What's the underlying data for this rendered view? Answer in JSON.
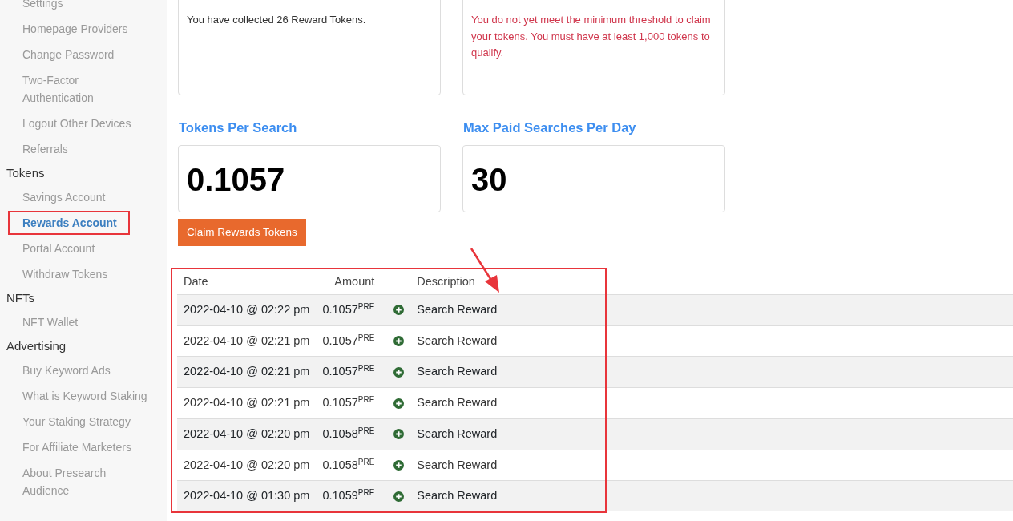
{
  "sidebar": {
    "groups": [
      {
        "items": [
          {
            "label": "Settings",
            "selected": false,
            "highlighted": false
          },
          {
            "label": "Homepage Providers",
            "selected": false,
            "highlighted": false
          },
          {
            "label": "Change Password",
            "selected": false,
            "highlighted": false
          },
          {
            "label": "Two-Factor Authentication",
            "selected": false,
            "highlighted": false
          },
          {
            "label": "Logout Other Devices",
            "selected": false,
            "highlighted": false
          },
          {
            "label": "Referrals",
            "selected": false,
            "highlighted": false
          }
        ]
      },
      {
        "heading": "Tokens",
        "items": [
          {
            "label": "Savings Account",
            "selected": false,
            "highlighted": false
          },
          {
            "label": "Rewards Account",
            "selected": true,
            "highlighted": true
          },
          {
            "label": "Portal Account",
            "selected": false,
            "highlighted": false
          },
          {
            "label": "Withdraw Tokens",
            "selected": false,
            "highlighted": false
          }
        ]
      },
      {
        "heading": "NFTs",
        "items": [
          {
            "label": "NFT Wallet",
            "selected": false,
            "highlighted": false
          }
        ]
      },
      {
        "heading": "Advertising",
        "items": [
          {
            "label": "Buy Keyword Ads",
            "selected": false,
            "highlighted": false
          },
          {
            "label": "What is Keyword Staking",
            "selected": false,
            "highlighted": false
          },
          {
            "label": "Your Staking Strategy",
            "selected": false,
            "highlighted": false
          },
          {
            "label": "For Affiliate Marketers",
            "selected": false,
            "highlighted": false
          },
          {
            "label": "About Presearch Audience",
            "selected": false,
            "highlighted": false
          }
        ]
      }
    ]
  },
  "info_cards": [
    {
      "text": "You have collected 26 Reward Tokens.",
      "kind": "normal"
    },
    {
      "text": "You do not yet meet the minimum threshold to claim your tokens. You must have at least 1,000 tokens to qualify.",
      "kind": "warning"
    }
  ],
  "stats": [
    {
      "title": "Tokens Per Search",
      "value": "0.1057"
    },
    {
      "title": "Max Paid Searches Per Day",
      "value": "30"
    }
  ],
  "claim_button": "Claim Rewards Tokens",
  "table": {
    "highlighted": true,
    "columns": [
      "Date",
      "Amount",
      "Description"
    ],
    "rows": [
      {
        "date": "2022-04-10 @ 02:22 pm",
        "amount": "0.1057$^{PRE}$",
        "description": "Search Reward"
      },
      {
        "date": "2022-04-10 @ 02:21 pm",
        "amount": "0.1057$^{PRE}$",
        "description": "Search Reward"
      },
      {
        "date": "2022-04-10 @ 02:21 pm",
        "amount": "0.1057$^{PRE}$",
        "description": "Search Reward"
      },
      {
        "date": "2022-04-10 @ 02:21 pm",
        "amount": "0.1057$^{PRE}$",
        "description": "Search Reward"
      },
      {
        "date": "2022-04-10 @ 02:20 pm",
        "amount": "0.1058$^{PRE}$",
        "description": "Search Reward"
      },
      {
        "date": "2022-04-10 @ 02:20 pm",
        "amount": "0.1058$^{PRE}$",
        "description": "Search Reward"
      },
      {
        "date": "2022-04-10 @ 01:30 pm",
        "amount": "0.1059$^{PRE}$",
        "description": "Search Reward"
      }
    ]
  }
}
